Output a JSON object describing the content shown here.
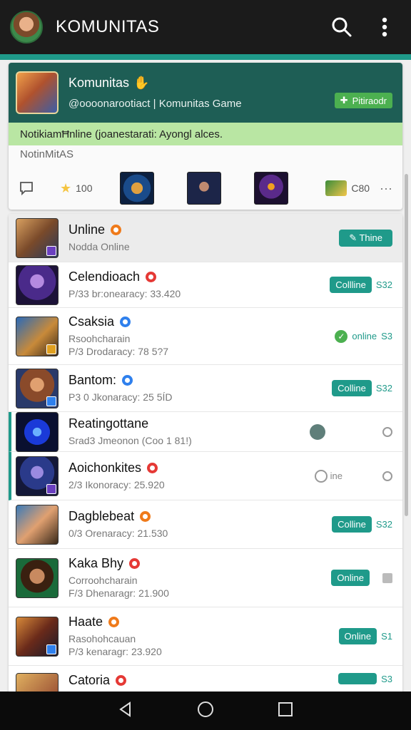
{
  "appbar": {
    "title": "KOMUNITAS"
  },
  "header": {
    "name": "Komunitas",
    "subtitle": "@oooonarootiact | Komunitas Game",
    "badge": "Pitiraodr",
    "notice": "NotikiamĦnline (joanestarati: Ayongl alces.",
    "section": "NotinMitAS",
    "stats": {
      "stars": "100",
      "gift": "C80"
    }
  },
  "rows": [
    {
      "name": "Unline",
      "line1": "Nodda Online",
      "line2": "",
      "status_label": "Thine"
    },
    {
      "name": "Celendioach",
      "line1": "P/33 br:onearacy: 33.420",
      "line2": "",
      "status_label": "Collline",
      "extra": "S32"
    },
    {
      "name": "Csaksia",
      "line1": "Rsoohcharain",
      "line2": "P/3 Drodaracy: 78 5?7",
      "status_label": "online",
      "extra": "S3"
    },
    {
      "name": "Bantom:",
      "line1": "P3 0 Jkonaracy: 25 5ÍD",
      "line2": "",
      "status_label": "Colline",
      "extra": "S32"
    },
    {
      "name": "Reatingottane",
      "line1": "Srad3 Jmeonon (Coo 1 81!)",
      "line2": "",
      "status_label": ""
    },
    {
      "name": "Aoichonkites",
      "line1": "2/3 Ikonoracy: 25.920",
      "line2": "",
      "status_label": "ine"
    },
    {
      "name": "Dagblebeat",
      "line1": "0/3 Orenaracy: 21.530",
      "line2": "",
      "status_label": "Colline",
      "extra": "S32"
    },
    {
      "name": "Kaka Bhy",
      "line1": "Corroohcharain",
      "line2": "F/3 Dhenaragr: 21.900",
      "status_label": "Online"
    },
    {
      "name": "Haate",
      "line1": "Rasohohcauan",
      "line2": "P/3 kenaragr: 23.920",
      "status_label": "Online",
      "extra": "S1"
    },
    {
      "name": "Catoria",
      "line1": "",
      "line2": "",
      "status_label": "",
      "extra": "S3"
    }
  ],
  "colors": {
    "accent": "#1f9a8a",
    "header": "#1e5e55",
    "notice": "#b9e6a3"
  },
  "icons": [
    "search-icon",
    "more-vert-icon",
    "back-icon",
    "home-icon",
    "recents-icon"
  ]
}
